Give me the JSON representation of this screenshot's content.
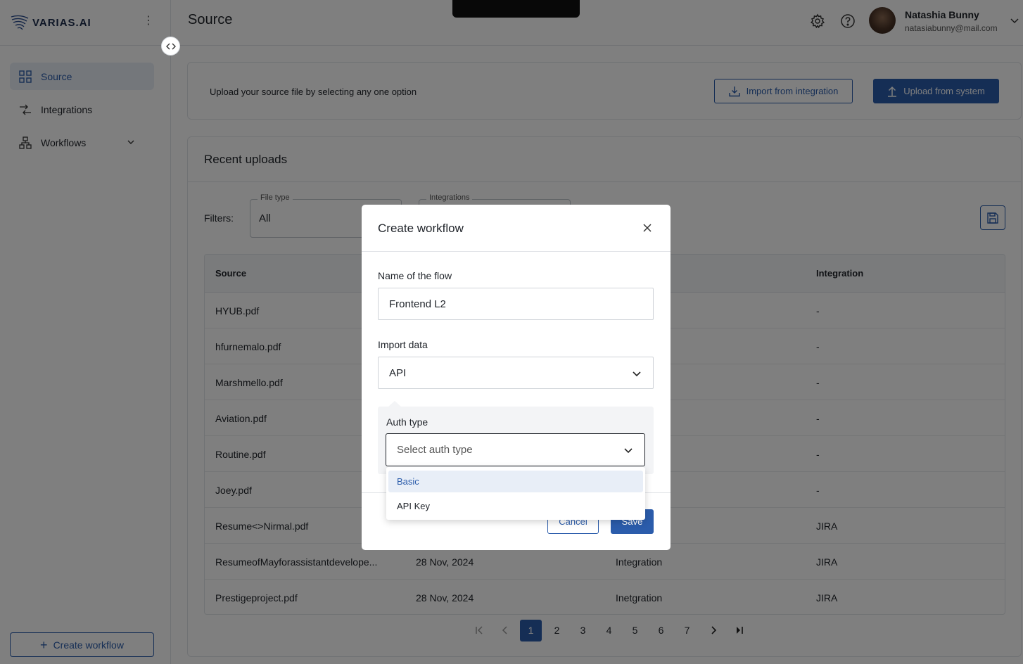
{
  "brand": {
    "name": "VARIAS.AI"
  },
  "sidebar": {
    "items": [
      {
        "label": "Source",
        "icon": "grid-icon"
      },
      {
        "label": "Integrations",
        "icon": "arrows-icon"
      },
      {
        "label": "Workflows",
        "icon": "hierarchy-icon"
      }
    ],
    "create_label": "Create workflow"
  },
  "header": {
    "title": "Source",
    "user_name": "Natashia Bunny",
    "user_email": "natasiabunny@mail.com"
  },
  "upload": {
    "text": "Upload your source file by selecting any one option",
    "import_label": "Import from integration",
    "upload_label": "Upload from system"
  },
  "recent": {
    "title": "Recent uploads",
    "filters_label": "Filters:",
    "filter_file_type": {
      "legend": "File type",
      "value": "All"
    },
    "filter_integrations": {
      "legend": "Integrations"
    },
    "columns": [
      "Source",
      "Integration"
    ],
    "rows": [
      {
        "source": "HYUB.pdf",
        "date": "",
        "type": "",
        "integration": "-"
      },
      {
        "source": "hfurnemalo.pdf",
        "date": "",
        "type": "",
        "integration": "-"
      },
      {
        "source": "Marshmello.pdf",
        "date": "",
        "type": "",
        "integration": "-"
      },
      {
        "source": "Aviation.pdf",
        "date": "",
        "type": "",
        "integration": "-"
      },
      {
        "source": "Routine.pdf",
        "date": "",
        "type": "",
        "integration": "-"
      },
      {
        "source": "Joey.pdf",
        "date": "",
        "type": "",
        "integration": "-"
      },
      {
        "source": "Resume<>Nirmal.pdf",
        "date": "",
        "type": "",
        "integration": "JIRA"
      },
      {
        "source": "ResumeofMayforassistantdevelope...",
        "date": "28 Nov, 2024",
        "type": "Integration",
        "integration": "JIRA"
      },
      {
        "source": "Prestigeproject.pdf",
        "date": "28 Nov, 2024",
        "type": "Inetgration",
        "integration": "JIRA"
      }
    ]
  },
  "pagination": {
    "pages": [
      "1",
      "2",
      "3",
      "4",
      "5",
      "6",
      "7"
    ],
    "current": "1"
  },
  "modal": {
    "title": "Create workflow",
    "name_label": "Name of the flow",
    "name_value": "Frontend L2",
    "import_label": "Import data",
    "import_value": "API",
    "auth_label": "Auth type",
    "auth_placeholder": "Select auth type",
    "auth_options": [
      "Basic",
      "API Key"
    ],
    "cancel_label": "Cancel",
    "save_label": "Save"
  },
  "colors": {
    "accent": "#2b5cab",
    "overlay": "rgba(0,0,0,0.5)"
  }
}
